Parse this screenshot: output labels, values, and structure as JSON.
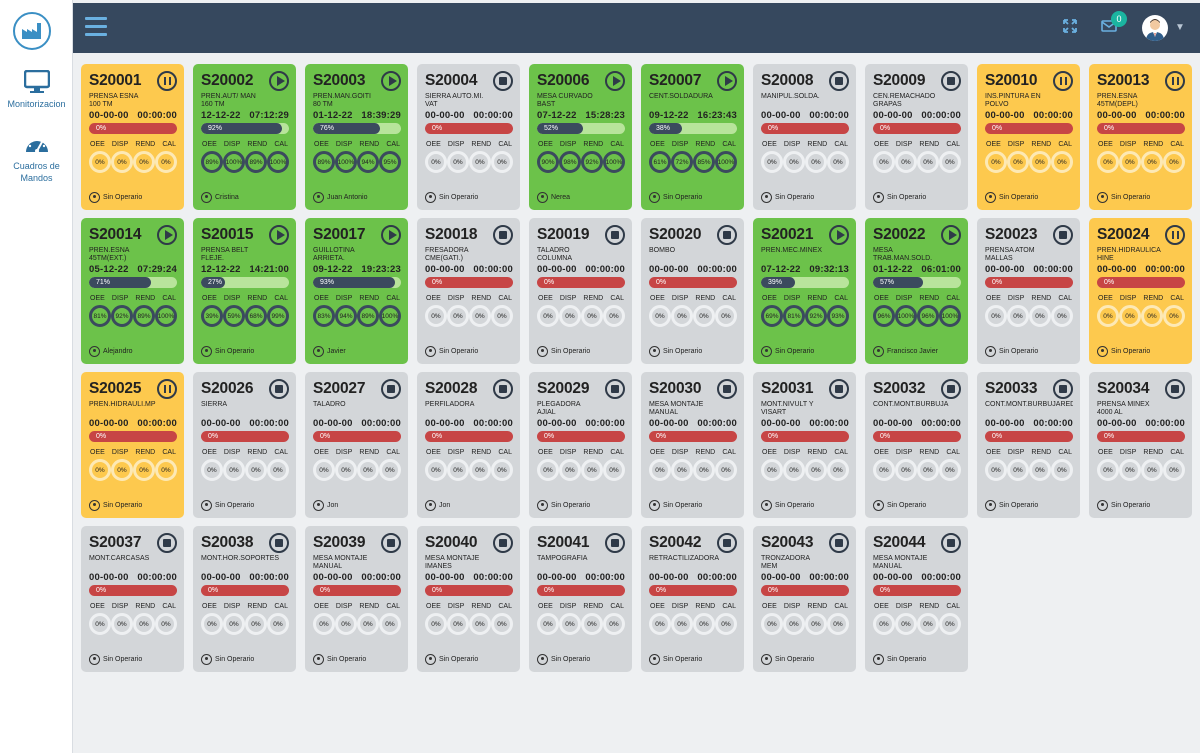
{
  "sidebar": {
    "items": [
      {
        "label": "Monitorizacion",
        "icon": "monitor-icon"
      },
      {
        "label": "Cuadros de Mandos",
        "icon": "dashboard-gauge-icon"
      }
    ]
  },
  "topbar": {
    "mail_count": "0"
  },
  "colors": {
    "yellow": "#fdc94e",
    "green": "#6cc24a",
    "grey": "#d3d6d9",
    "red": "#c74545",
    "dark": "#36485e"
  },
  "cards": [
    {
      "id": "S20001",
      "name": "PRENSA ESNA\n100 TM",
      "date": "00-00-00",
      "time": "00:00:00",
      "pct": "0%",
      "fill": 0,
      "status": "pause",
      "color": "yellow",
      "oee": "0%",
      "disp": "0%",
      "rend": "0%",
      "cal": "0%",
      "operator": "Sin Operario"
    },
    {
      "id": "S20002",
      "name": "PREN.AUT/ MAN\n160 TM",
      "date": "12-12-22",
      "time": "07:12:29",
      "pct": "92%",
      "fill": 0.92,
      "status": "play",
      "color": "green",
      "oee": "89%",
      "disp": "100%",
      "rend": "89%",
      "cal": "100%",
      "operator": "Cristina"
    },
    {
      "id": "S20003",
      "name": "PREN.MAN.GOITI\n80 TM",
      "date": "01-12-22",
      "time": "18:39:29",
      "pct": "76%",
      "fill": 0.76,
      "status": "play",
      "color": "green",
      "oee": "89%",
      "disp": "100%",
      "rend": "94%",
      "cal": "95%",
      "operator": "Juan Antonio"
    },
    {
      "id": "S20004",
      "name": "SIERRA AUTO.MI.\nVAT",
      "date": "00-00-00",
      "time": "00:00:00",
      "pct": "0%",
      "fill": 0,
      "status": "stop",
      "color": "grey",
      "oee": "0%",
      "disp": "0%",
      "rend": "0%",
      "cal": "0%",
      "operator": "Sin Operario"
    },
    {
      "id": "S20006",
      "name": "MESA CURVADO\nBAST",
      "date": "07-12-22",
      "time": "15:28:23",
      "pct": "52%",
      "fill": 0.52,
      "status": "play",
      "color": "green",
      "oee": "90%",
      "disp": "98%",
      "rend": "92%",
      "cal": "100%",
      "operator": "Nerea"
    },
    {
      "id": "S20007",
      "name": "CENT.SOLDADURA",
      "date": "09-12-22",
      "time": "16:23:43",
      "pct": "38%",
      "fill": 0.38,
      "status": "play",
      "color": "green",
      "oee": "61%",
      "disp": "72%",
      "rend": "85%",
      "cal": "100%",
      "operator": "Sin Operario"
    },
    {
      "id": "S20008",
      "name": "MANIPUL.SOLDA.",
      "date": "00-00-00",
      "time": "00:00:00",
      "pct": "0%",
      "fill": 0,
      "status": "stop",
      "color": "grey",
      "oee": "0%",
      "disp": "0%",
      "rend": "0%",
      "cal": "0%",
      "operator": "Sin Operario"
    },
    {
      "id": "S20009",
      "name": "CEN.REMACHADO\nGRAPAS",
      "date": "00-00-00",
      "time": "00:00:00",
      "pct": "0%",
      "fill": 0,
      "status": "stop",
      "color": "grey",
      "oee": "0%",
      "disp": "0%",
      "rend": "0%",
      "cal": "0%",
      "operator": "Sin Operario"
    },
    {
      "id": "S20010",
      "name": "INS.PINTURA EN\nPOLVO",
      "date": "00-00-00",
      "time": "00:00:00",
      "pct": "0%",
      "fill": 0,
      "status": "pause",
      "color": "yellow",
      "oee": "0%",
      "disp": "0%",
      "rend": "0%",
      "cal": "0%",
      "operator": "Sin Operario"
    },
    {
      "id": "S20013",
      "name": "PREN.ESNA\n45TM(DEPL)",
      "date": "00-00-00",
      "time": "00:00:00",
      "pct": "0%",
      "fill": 0,
      "status": "pause",
      "color": "yellow",
      "oee": "0%",
      "disp": "0%",
      "rend": "0%",
      "cal": "0%",
      "operator": "Sin Operario"
    },
    {
      "id": "S20014",
      "name": "PREN.ESNA\n45TM(EXT.)",
      "date": "05-12-22",
      "time": "07:29:24",
      "pct": "71%",
      "fill": 0.71,
      "status": "play",
      "color": "green",
      "oee": "81%",
      "disp": "92%",
      "rend": "89%",
      "cal": "100%",
      "operator": "Alejandro"
    },
    {
      "id": "S20015",
      "name": "PRENSA BELT\nFLEJE.",
      "date": "12-12-22",
      "time": "14:21:00",
      "pct": "27%",
      "fill": 0.27,
      "status": "play",
      "color": "green",
      "oee": "39%",
      "disp": "59%",
      "rend": "68%",
      "cal": "99%",
      "operator": "Sin Operario"
    },
    {
      "id": "S20017",
      "name": "GUILLOTINA\nARRIETA.",
      "date": "09-12-22",
      "time": "19:23:23",
      "pct": "93%",
      "fill": 0.93,
      "status": "play",
      "color": "green",
      "oee": "83%",
      "disp": "94%",
      "rend": "89%",
      "cal": "100%",
      "operator": "Javier"
    },
    {
      "id": "S20018",
      "name": "FRESADORA\nCME(GATI.)",
      "date": "00-00-00",
      "time": "00:00:00",
      "pct": "0%",
      "fill": 0,
      "status": "stop",
      "color": "grey",
      "oee": "0%",
      "disp": "0%",
      "rend": "0%",
      "cal": "0%",
      "operator": "Sin Operario"
    },
    {
      "id": "S20019",
      "name": "TALADRO\nCOLUMNA",
      "date": "00-00-00",
      "time": "00:00:00",
      "pct": "0%",
      "fill": 0,
      "status": "stop",
      "color": "grey",
      "oee": "0%",
      "disp": "0%",
      "rend": "0%",
      "cal": "0%",
      "operator": "Sin Operario"
    },
    {
      "id": "S20020",
      "name": "BOMBO",
      "date": "00-00-00",
      "time": "00:00:00",
      "pct": "0%",
      "fill": 0,
      "status": "stop",
      "color": "grey",
      "oee": "0%",
      "disp": "0%",
      "rend": "0%",
      "cal": "0%",
      "operator": "Sin Operario"
    },
    {
      "id": "S20021",
      "name": "PREN.MEC.MINEX",
      "date": "07-12-22",
      "time": "09:32:13",
      "pct": "39%",
      "fill": 0.39,
      "status": "play",
      "color": "green",
      "oee": "69%",
      "disp": "81%",
      "rend": "92%",
      "cal": "93%",
      "operator": "Sin Operario"
    },
    {
      "id": "S20022",
      "name": "MESA\nTRAB.MAN.SOLD.",
      "date": "01-12-22",
      "time": "06:01:00",
      "pct": "57%",
      "fill": 0.57,
      "status": "play",
      "color": "green",
      "oee": "96%",
      "disp": "100%",
      "rend": "96%",
      "cal": "100%",
      "operator": "Francisco Javier"
    },
    {
      "id": "S20023",
      "name": "PRENSA ATOM\nMALLAS",
      "date": "00-00-00",
      "time": "00:00:00",
      "pct": "0%",
      "fill": 0,
      "status": "stop",
      "color": "grey",
      "oee": "0%",
      "disp": "0%",
      "rend": "0%",
      "cal": "0%",
      "operator": "Sin Operario"
    },
    {
      "id": "S20024",
      "name": "PREN.HIDRAULICA\nHINE",
      "date": "00-00-00",
      "time": "00:00:00",
      "pct": "0%",
      "fill": 0,
      "status": "pause",
      "color": "yellow",
      "oee": "0%",
      "disp": "0%",
      "rend": "0%",
      "cal": "0%",
      "operator": "Sin Operario"
    },
    {
      "id": "S20025",
      "name": "PREN.HIDRAULI.MP",
      "date": "00-00-00",
      "time": "00:00:00",
      "pct": "0%",
      "fill": 0,
      "status": "pause",
      "color": "yellow",
      "oee": "0%",
      "disp": "0%",
      "rend": "0%",
      "cal": "0%",
      "operator": "Sin Operario"
    },
    {
      "id": "S20026",
      "name": "SIERRA",
      "date": "00-00-00",
      "time": "00:00:00",
      "pct": "0%",
      "fill": 0,
      "status": "stop",
      "color": "grey",
      "oee": "0%",
      "disp": "0%",
      "rend": "0%",
      "cal": "0%",
      "operator": "Sin Operario"
    },
    {
      "id": "S20027",
      "name": "TALADRO",
      "date": "00-00-00",
      "time": "00:00:00",
      "pct": "0%",
      "fill": 0,
      "status": "stop",
      "color": "grey",
      "oee": "0%",
      "disp": "0%",
      "rend": "0%",
      "cal": "0%",
      "operator": "Jon"
    },
    {
      "id": "S20028",
      "name": "PERFILADORA",
      "date": "00-00-00",
      "time": "00:00:00",
      "pct": "0%",
      "fill": 0,
      "status": "stop",
      "color": "grey",
      "oee": "0%",
      "disp": "0%",
      "rend": "0%",
      "cal": "0%",
      "operator": "Jon"
    },
    {
      "id": "S20029",
      "name": "PLEGADORA\nAJIAL",
      "date": "00-00-00",
      "time": "00:00:00",
      "pct": "0%",
      "fill": 0,
      "status": "stop",
      "color": "grey",
      "oee": "0%",
      "disp": "0%",
      "rend": "0%",
      "cal": "0%",
      "operator": "Sin Operario"
    },
    {
      "id": "S20030",
      "name": "MESA MONTAJE\nMANUAL",
      "date": "00-00-00",
      "time": "00:00:00",
      "pct": "0%",
      "fill": 0,
      "status": "stop",
      "color": "grey",
      "oee": "0%",
      "disp": "0%",
      "rend": "0%",
      "cal": "0%",
      "operator": "Sin Operario"
    },
    {
      "id": "S20031",
      "name": "MONT.NIVULT Y\nVISART",
      "date": "00-00-00",
      "time": "00:00:00",
      "pct": "0%",
      "fill": 0,
      "status": "stop",
      "color": "grey",
      "oee": "0%",
      "disp": "0%",
      "rend": "0%",
      "cal": "0%",
      "operator": "Sin Operario"
    },
    {
      "id": "S20032",
      "name": "CONT.MONT.BURBUJA",
      "date": "00-00-00",
      "time": "00:00:00",
      "pct": "0%",
      "fill": 0,
      "status": "stop",
      "color": "grey",
      "oee": "0%",
      "disp": "0%",
      "rend": "0%",
      "cal": "0%",
      "operator": "Sin Operario"
    },
    {
      "id": "S20033",
      "name": "CONT.MONT.BURBUJARED",
      "date": "00-00-00",
      "time": "00:00:00",
      "pct": "0%",
      "fill": 0,
      "status": "stop",
      "color": "grey",
      "oee": "0%",
      "disp": "0%",
      "rend": "0%",
      "cal": "0%",
      "operator": "Sin Operario"
    },
    {
      "id": "S20034",
      "name": "PRENSA MINEX\n4000 AL",
      "date": "00-00-00",
      "time": "00:00:00",
      "pct": "0%",
      "fill": 0,
      "status": "stop",
      "color": "grey",
      "oee": "0%",
      "disp": "0%",
      "rend": "0%",
      "cal": "0%",
      "operator": "Sin Operario"
    },
    {
      "id": "S20037",
      "name": "MONT.CARCASAS",
      "date": "00-00-00",
      "time": "00:00:00",
      "pct": "0%",
      "fill": 0,
      "status": "stop",
      "color": "grey",
      "oee": "0%",
      "disp": "0%",
      "rend": "0%",
      "cal": "0%",
      "operator": "Sin Operario"
    },
    {
      "id": "S20038",
      "name": "MONT.HOR.SOPORTES",
      "date": "00-00-00",
      "time": "00:00:00",
      "pct": "0%",
      "fill": 0,
      "status": "stop",
      "color": "grey",
      "oee": "0%",
      "disp": "0%",
      "rend": "0%",
      "cal": "0%",
      "operator": "Sin Operario"
    },
    {
      "id": "S20039",
      "name": "MESA MONTAJE\nMANUAL",
      "date": "00-00-00",
      "time": "00:00:00",
      "pct": "0%",
      "fill": 0,
      "status": "stop",
      "color": "grey",
      "oee": "0%",
      "disp": "0%",
      "rend": "0%",
      "cal": "0%",
      "operator": "Sin Operario"
    },
    {
      "id": "S20040",
      "name": "MESA MONTAJE\nIMANES",
      "date": "00-00-00",
      "time": "00:00:00",
      "pct": "0%",
      "fill": 0,
      "status": "stop",
      "color": "grey",
      "oee": "0%",
      "disp": "0%",
      "rend": "0%",
      "cal": "0%",
      "operator": "Sin Operario"
    },
    {
      "id": "S20041",
      "name": "TAMPOGRAFIA",
      "date": "00-00-00",
      "time": "00:00:00",
      "pct": "0%",
      "fill": 0,
      "status": "stop",
      "color": "grey",
      "oee": "0%",
      "disp": "0%",
      "rend": "0%",
      "cal": "0%",
      "operator": "Sin Operario"
    },
    {
      "id": "S20042",
      "name": "RETRACTILIZADORA",
      "date": "00-00-00",
      "time": "00:00:00",
      "pct": "0%",
      "fill": 0,
      "status": "stop",
      "color": "grey",
      "oee": "0%",
      "disp": "0%",
      "rend": "0%",
      "cal": "0%",
      "operator": "Sin Operario"
    },
    {
      "id": "S20043",
      "name": "TRONZADORA\nMEM",
      "date": "00-00-00",
      "time": "00:00:00",
      "pct": "0%",
      "fill": 0,
      "status": "stop",
      "color": "grey",
      "oee": "0%",
      "disp": "0%",
      "rend": "0%",
      "cal": "0%",
      "operator": "Sin Operario"
    },
    {
      "id": "S20044",
      "name": "MESA MONTAJE\nMANUAL",
      "date": "00-00-00",
      "time": "00:00:00",
      "pct": "0%",
      "fill": 0,
      "status": "stop",
      "color": "grey",
      "oee": "0%",
      "disp": "0%",
      "rend": "0%",
      "cal": "0%",
      "operator": "Sin Operario"
    }
  ],
  "metric_labels": {
    "oee": "OEE",
    "disp": "DISP",
    "rend": "REND",
    "cal": "CAL"
  }
}
